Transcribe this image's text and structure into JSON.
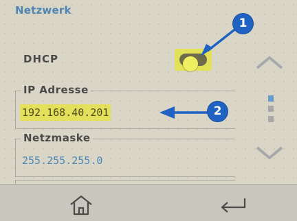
{
  "header": {
    "title": "Netzwerk"
  },
  "dhcp": {
    "label": "DHCP",
    "enabled": true
  },
  "fields": {
    "ip": {
      "label": "IP Adresse",
      "value": "192.168.40.201"
    },
    "mask": {
      "label": "Netzmaske",
      "value": "255.255.255.0"
    }
  },
  "scroll": {
    "up_icon": "chevron-up-icon",
    "down_icon": "chevron-down-icon",
    "dot_count": 3,
    "active_dot": 1
  },
  "nav": {
    "home_icon": "home-icon",
    "back_icon": "return-arrow-icon"
  },
  "annotations": [
    {
      "number": "1",
      "target": "dhcp-toggle"
    },
    {
      "number": "2",
      "target": "ip-address-value"
    }
  ],
  "colors": {
    "accent_blue": "#4f86b4",
    "highlight_yellow": "#e4e05c",
    "badge_blue": "#1f62c2"
  }
}
